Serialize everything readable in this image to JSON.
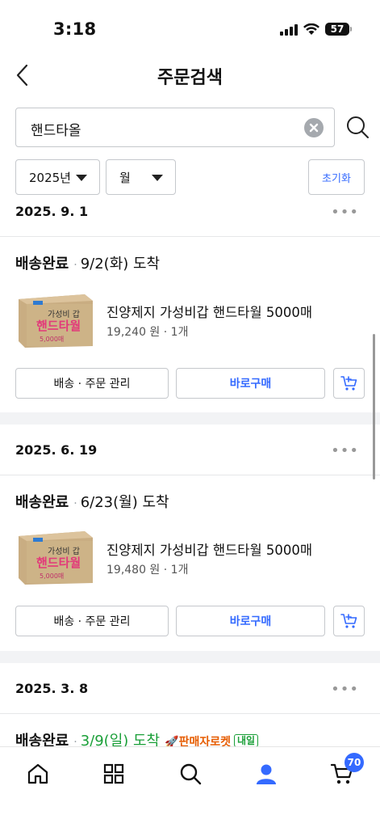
{
  "status": {
    "time": "3:18",
    "battery": "57"
  },
  "header": {
    "title": "주문검색"
  },
  "search": {
    "value": "핸드타올"
  },
  "filters": {
    "year": "2025년",
    "month": "월",
    "reset": "초기화"
  },
  "orders": [
    {
      "date": "2025. 9. 1",
      "status": "배송완료",
      "arrival": "9/2(화) 도착",
      "product": "진양제지 가성비갑 핸드타월 5000매",
      "price": "19,240 원 · 1개",
      "manage_label": "배송 · 주문 관리",
      "buy_label": "바로구매"
    },
    {
      "date": "2025. 6. 19",
      "status": "배송완료",
      "arrival": "6/23(월) 도착",
      "product": "진양제지 가성비갑 핸드타월 5000매",
      "price": "19,480 원 · 1개",
      "manage_label": "배송 · 주문 관리",
      "buy_label": "바로구매"
    },
    {
      "date": "2025. 3. 8",
      "status": "배송완료",
      "arrival": "3/9(일) 도착",
      "badge": "판매자로켓",
      "badge2": "내일"
    }
  ],
  "product_image": {
    "line1": "가성비 갑",
    "line2": "핸드타월",
    "line3": "5,000매"
  },
  "tabbar": {
    "cart_count": "70"
  },
  "colors": {
    "accent": "#346aff",
    "arrival_green": "#1a9f38",
    "rocket_orange": "#e65c00"
  }
}
